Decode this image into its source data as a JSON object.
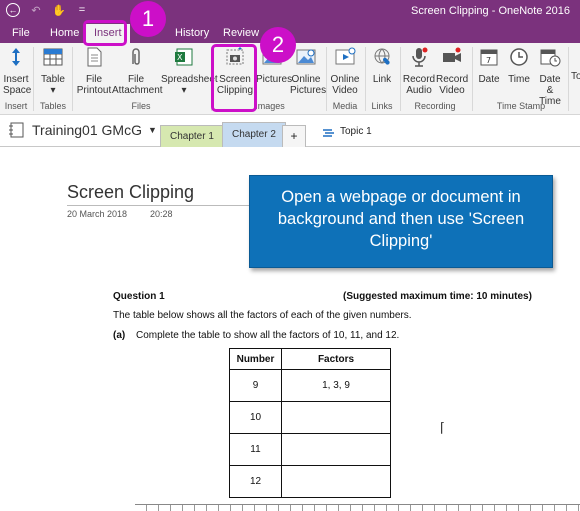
{
  "window": {
    "title": "Screen Clipping  -  OneNote 2016"
  },
  "qat": {
    "back_icon": "back-arrow-icon",
    "undo_icon": "undo-icon",
    "touch_icon": "touch-mode-icon",
    "customize": "="
  },
  "tabs": [
    {
      "label": "File"
    },
    {
      "label": "Home"
    },
    {
      "label": "Insert"
    },
    {
      "label": "History"
    },
    {
      "label": "Review"
    }
  ],
  "ribbon": {
    "buttons": [
      {
        "label1": "Insert",
        "label2": "Space"
      },
      {
        "label1": "Table",
        "label2": "▾"
      },
      {
        "label1": "File",
        "label2": "Printout"
      },
      {
        "label1": "File",
        "label2": "Attachment"
      },
      {
        "label1": "Spreadsheet",
        "label2": "▾"
      },
      {
        "label1": "Screen",
        "label2": "Clipping"
      },
      {
        "label1": "Pictures",
        "label2": ""
      },
      {
        "label1": "Online",
        "label2": "Pictures"
      },
      {
        "label1": "Online",
        "label2": "Video"
      },
      {
        "label1": "Link",
        "label2": ""
      },
      {
        "label1": "Record",
        "label2": "Audio"
      },
      {
        "label1": "Record",
        "label2": "Video"
      },
      {
        "label1": "Date",
        "label2": ""
      },
      {
        "label1": "Time",
        "label2": ""
      },
      {
        "label1": "Date &",
        "label2": "Time"
      },
      {
        "label1": "To",
        "label2": ""
      }
    ],
    "groups": [
      "Insert",
      "Tables",
      "Files",
      "Images",
      "Media",
      "Links",
      "Recording",
      "Time Stamp"
    ]
  },
  "notebook": {
    "name": "Training01 GMcG",
    "sections": [
      "Chapter 1",
      "Chapter 2"
    ],
    "add_section": "+",
    "topic": "Topic 1"
  },
  "page": {
    "title": "Screen Clipping",
    "date": "20 March 2018",
    "time": "20:28"
  },
  "callout": {
    "text": "Open a webpage or document in background and then use 'Screen Clipping'",
    "step1": "1",
    "step2": "2"
  },
  "question": {
    "heading": "Question 1",
    "time_note": "(Suggested maximum time: 10 minutes)",
    "intro": "The table below shows all the factors of each of the given numbers.",
    "part_label": "(a)",
    "part_text": "Complete the table to show all the factors of 10, 11, and 12.",
    "table": {
      "headers": [
        "Number",
        "Factors"
      ],
      "rows": [
        {
          "number": "9",
          "factors": "1,  3,  9"
        },
        {
          "number": "10",
          "factors": ""
        },
        {
          "number": "11",
          "factors": ""
        },
        {
          "number": "12",
          "factors": ""
        }
      ]
    }
  },
  "colors": {
    "accent": "#7b327d",
    "callout": "#0e71b8",
    "highlight": "#cc0fc8"
  }
}
